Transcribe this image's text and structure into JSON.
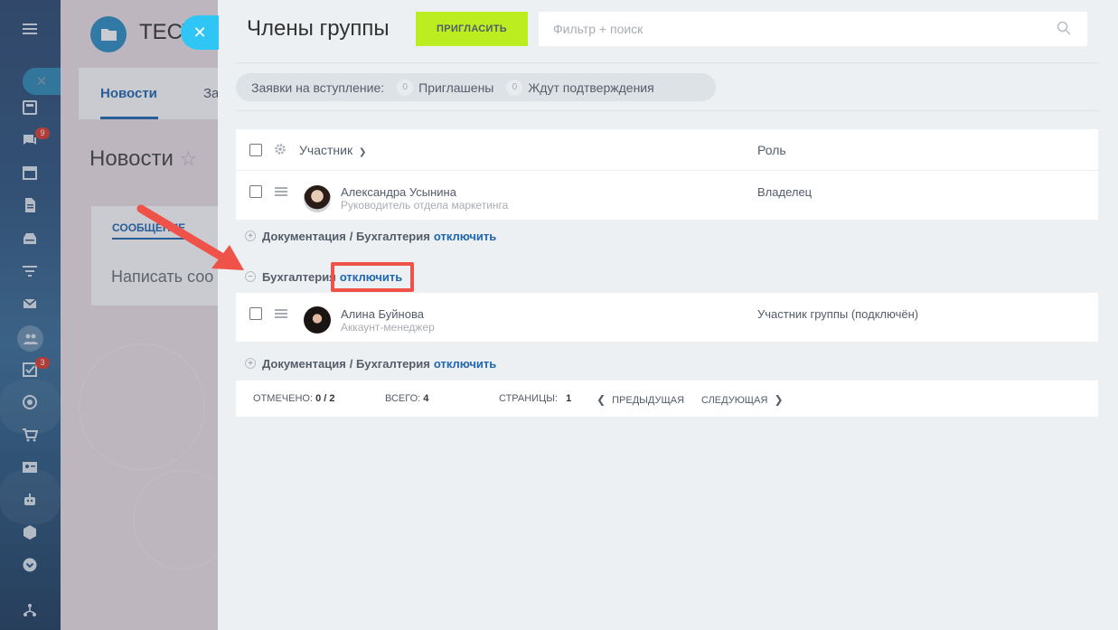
{
  "rail": {
    "badges": {
      "chat": "9",
      "tasks": "3"
    }
  },
  "background": {
    "group_title": "ТЕСТ",
    "tab_news": "Новости",
    "tab_next": "За",
    "page_title": "Новости",
    "feed_tab": "СООБЩЕНИЕ",
    "feed_placeholder": "Написать соо"
  },
  "panel": {
    "title": "Члены группы",
    "invite_label": "ПРИГЛАСИТЬ",
    "search_placeholder": "Фильтр + поиск",
    "requests": {
      "label": "Заявки на вступление:",
      "invited_count": "0",
      "invited_label": "Приглашены",
      "waiting_count": "0",
      "waiting_label": "Ждут подтверждения"
    },
    "grid": {
      "col_member": "Участник",
      "col_role": "Роль",
      "rows": [
        {
          "name": "Александра Усынина",
          "position": "Руководитель отдела маркетинга",
          "role": "Владелец"
        },
        {
          "name": "Алина Буйнова",
          "position": "Аккаунт-менеджер",
          "role": "Участник группы (подключён)"
        }
      ]
    },
    "departments": [
      {
        "name": "Документация",
        "path": "/ Бухгалтерия",
        "action": "отключить"
      },
      {
        "name": "Бухгалтерия",
        "action": "отключить"
      },
      {
        "name": "Документация",
        "path": "/ Бухгалтерия",
        "action": "отключить"
      }
    ],
    "footer": {
      "selected_label": "ОТМЕЧЕНО:",
      "selected_value": "0 / 2",
      "total_label": "ВСЕГО:",
      "total_value": "4",
      "pages_label": "СТРАНИЦЫ:",
      "pages_value": "1",
      "prev": "ПРЕДЫДУЩАЯ",
      "next": "СЛЕДУЮЩАЯ"
    }
  },
  "colors": {
    "accent_green": "#bbed21",
    "close_blue": "#2fc6f6",
    "link_blue": "#2067b0",
    "annotation_red": "#ef5248"
  }
}
